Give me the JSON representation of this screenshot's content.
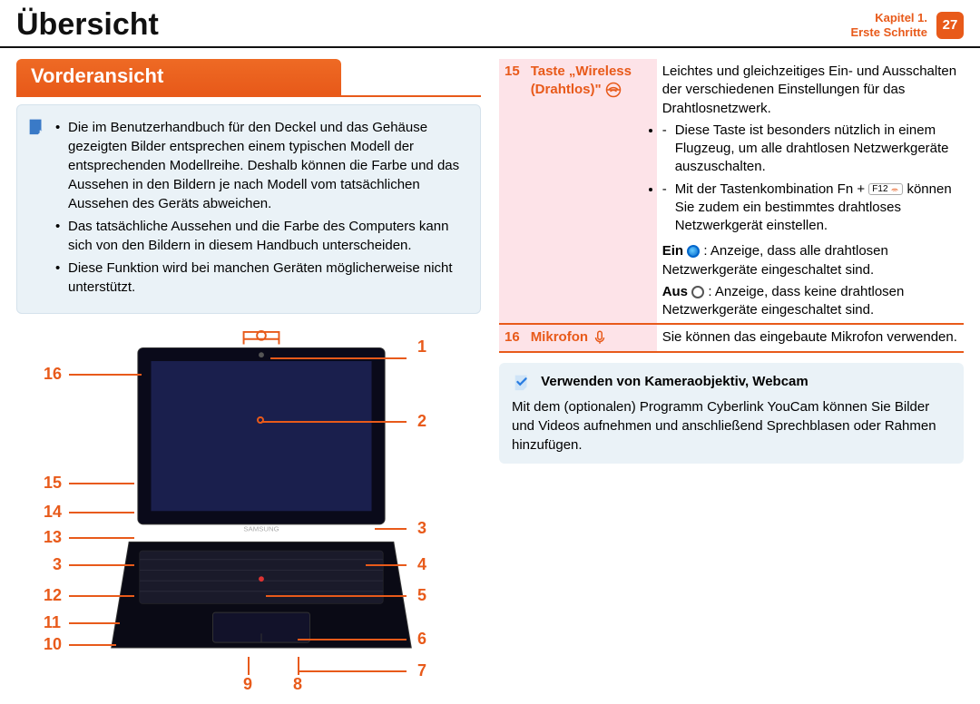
{
  "header": {
    "title": "Übersicht",
    "chapter_line1": "Kapitel 1.",
    "chapter_line2": "Erste Schritte",
    "page_number": "27"
  },
  "section": {
    "title": "Vorderansicht"
  },
  "notes": [
    "Die im Benutzerhandbuch für den Deckel und das Gehäuse gezeigten Bilder entsprechen einem typischen Modell der entsprechenden Modellreihe. Deshalb können die Farbe und das Aussehen in den Bildern je nach Modell vom tatsächlichen Aussehen des Geräts abweichen.",
    "Das tatsächliche Aussehen und die Farbe des Computers kann sich von den Bildern in diesem Handbuch unterscheiden.",
    "Diese Funktion wird bei manchen Geräten möglicherweise nicht unterstützt."
  ],
  "callouts_right": [
    "1",
    "2",
    "3",
    "4",
    "5",
    "6",
    "7"
  ],
  "callouts_left": [
    "16",
    "15",
    "14",
    "13",
    "3",
    "12",
    "11",
    "10"
  ],
  "callouts_bottom": [
    "9",
    "8"
  ],
  "row15": {
    "num": "15",
    "name": "Taste „Wireless (Drahtlos)\"",
    "desc_intro": "Leichtes und gleichzeitiges Ein- und Ausschalten der verschiedenen Einstellungen für das Drahtlosnetzwerk.",
    "desc_b1": "Diese Taste ist besonders nützlich in einem Flugzeug, um alle drahtlosen Netzwerkgeräte auszuschalten.",
    "desc_b2a": "Mit der Tastenkombination Fn + ",
    "desc_b2_key": "F12",
    "desc_b2b": " können Sie zudem ein bestimmtes drahtloses Netzwerkgerät einstellen.",
    "ein_label": "Ein",
    "ein_text": " : Anzeige, dass alle drahtlosen Netzwerkgeräte eingeschaltet sind.",
    "aus_label": "Aus",
    "aus_text": " : Anzeige, dass keine drahtlosen Netzwerkgeräte eingeschaltet sind."
  },
  "row16": {
    "num": "16",
    "name": "Mikrofon",
    "desc": "Sie können das eingebaute Mikrofon verwenden."
  },
  "tip": {
    "title": "Verwenden von Kameraobjektiv, Webcam",
    "body": "Mit dem (optionalen) Programm Cyberlink YouCam können Sie Bilder und Videos aufnehmen und anschließend Sprechblasen oder Rahmen hinzufügen."
  }
}
